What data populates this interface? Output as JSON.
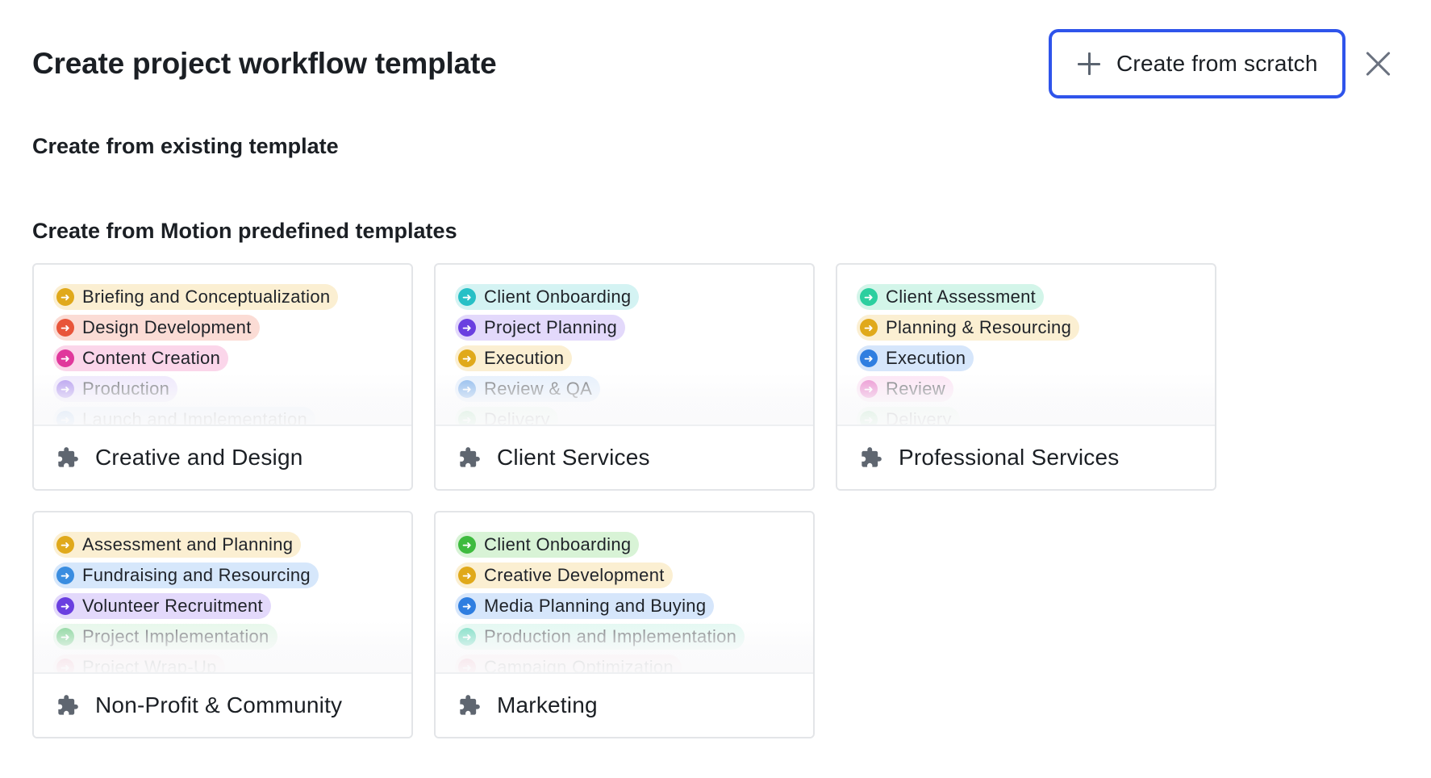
{
  "header": {
    "title": "Create project workflow template",
    "scratch_button_label": "Create from scratch"
  },
  "sections": {
    "existing": "Create from existing template",
    "predefined": "Create from Motion predefined templates"
  },
  "templates": [
    {
      "name": "Creative and Design",
      "stages": [
        {
          "label": "Briefing and Conceptualization",
          "color": "#e0a91b",
          "bg": "#fbefd2"
        },
        {
          "label": "Design Development",
          "color": "#e8553a",
          "bg": "#fbdcd5"
        },
        {
          "label": "Content Creation",
          "color": "#e0389c",
          "bg": "#fbd6ea"
        },
        {
          "label": "Production",
          "color": "#8a62e6",
          "bg": "#e6dcfb"
        },
        {
          "label": "Launch and Implementation",
          "color": "#4a90e2",
          "bg": "#d9e8fb"
        }
      ]
    },
    {
      "name": "Client Services",
      "stages": [
        {
          "label": "Client Onboarding",
          "color": "#27c0c6",
          "bg": "#d4f3f3"
        },
        {
          "label": "Project Planning",
          "color": "#6a3fe0",
          "bg": "#e3d9fb"
        },
        {
          "label": "Execution",
          "color": "#e0a91b",
          "bg": "#fbefd2"
        },
        {
          "label": "Review & QA",
          "color": "#4a90e2",
          "bg": "#d9e8fb"
        },
        {
          "label": "Delivery",
          "color": "#3ebb5c",
          "bg": "#d8f3de"
        }
      ]
    },
    {
      "name": "Professional Services",
      "stages": [
        {
          "label": "Client Assessment",
          "color": "#2ccf9f",
          "bg": "#d3f5e9"
        },
        {
          "label": "Planning & Resourcing",
          "color": "#e0a91b",
          "bg": "#fbefd2"
        },
        {
          "label": "Execution",
          "color": "#2f7ee0",
          "bg": "#d6e6fb"
        },
        {
          "label": "Review",
          "color": "#e052b6",
          "bg": "#fbd8f0"
        },
        {
          "label": "Delivery",
          "color": "#3ebb5c",
          "bg": "#d8f3de"
        }
      ]
    },
    {
      "name": "Non-Profit & Community",
      "stages": [
        {
          "label": "Assessment and Planning",
          "color": "#e0a91b",
          "bg": "#fbefd2"
        },
        {
          "label": "Fundraising and Resourcing",
          "color": "#3a8de0",
          "bg": "#d6e7fb"
        },
        {
          "label": "Volunteer Recruitment",
          "color": "#6a3fe0",
          "bg": "#e3d9fb"
        },
        {
          "label": "Project Implementation",
          "color": "#3ebb5c",
          "bg": "#d8f3de"
        },
        {
          "label": "Project Wrap-Up",
          "color": "#e8557a",
          "bg": "#fbd9e2"
        }
      ]
    },
    {
      "name": "Marketing",
      "stages": [
        {
          "label": "Client Onboarding",
          "color": "#3ebb3e",
          "bg": "#d8f3d6"
        },
        {
          "label": "Creative Development",
          "color": "#e0a91b",
          "bg": "#fbefd2"
        },
        {
          "label": "Media Planning and Buying",
          "color": "#2f7ee0",
          "bg": "#d6e6fb"
        },
        {
          "label": "Production and Implementation",
          "color": "#2cc9a0",
          "bg": "#d3f5ea"
        },
        {
          "label": "Campaign Optimization",
          "color": "#e8557a",
          "bg": "#fbd9e2"
        }
      ]
    }
  ],
  "colors": {
    "accent": "#2f54eb",
    "icon_gray": "#6b7280"
  },
  "icons": {
    "plus": "plus-icon",
    "close": "close-icon",
    "template": "puzzle-piece-icon",
    "stage": "arrow-right-circle-icon"
  }
}
